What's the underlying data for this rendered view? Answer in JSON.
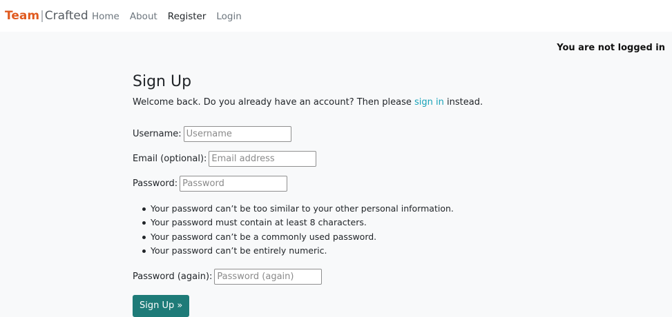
{
  "brand": {
    "team": "Team",
    "separator": "|",
    "crafted": "Crafted"
  },
  "nav": {
    "home": "Home",
    "about": "About",
    "register": "Register",
    "login": "Login"
  },
  "status": "You are not logged in",
  "signup": {
    "title": "Sign Up",
    "welcome_before": "Welcome back. Do you already have an account? Then please ",
    "welcome_link": "sign in",
    "welcome_after": " instead.",
    "username_label": "Username:",
    "username_placeholder": "Username",
    "username_value": "",
    "email_label": "Email (optional):",
    "email_placeholder": "Email address",
    "email_value": "",
    "password_label": "Password:",
    "password_placeholder": "Password",
    "password_value": "",
    "help": [
      "Your password can’t be too similar to your other personal information.",
      "Your password must contain at least 8 characters.",
      "Your password can’t be a commonly used password.",
      "Your password can’t be entirely numeric."
    ],
    "password2_label": "Password (again):",
    "password2_placeholder": "Password (again)",
    "password2_value": "",
    "submit_label": "Sign Up »"
  },
  "colors": {
    "brand_team": "#e05a1f",
    "link": "#17a2b8",
    "button": "#1e7b78",
    "background": "#f8f9fa"
  }
}
